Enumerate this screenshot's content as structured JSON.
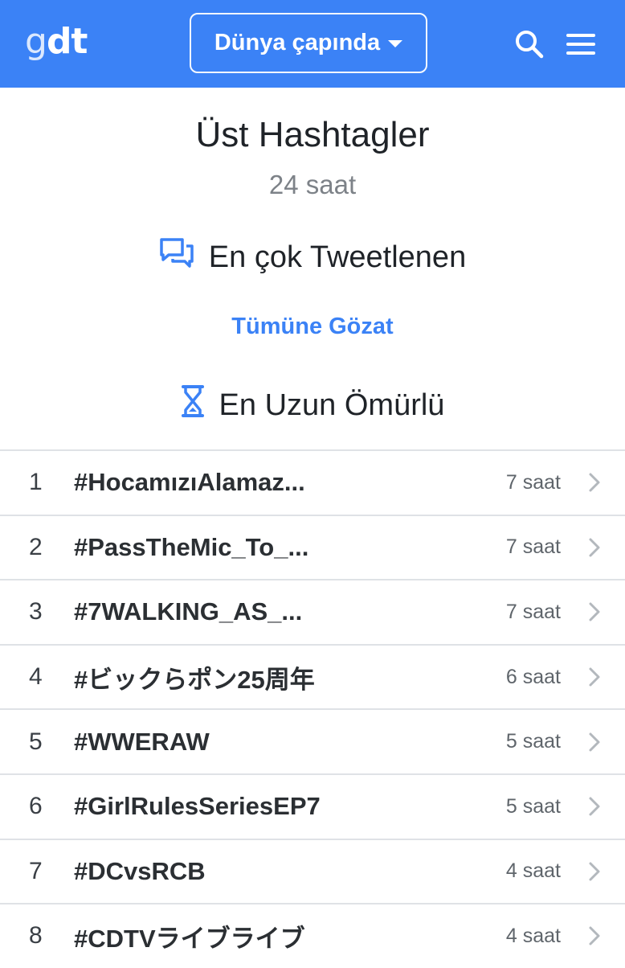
{
  "header": {
    "logo_g": "g",
    "logo_dt": "dt",
    "region_label": "Dünya çapında",
    "search_icon": "search-icon",
    "menu_icon": "menu-icon",
    "color": "#3b82f6"
  },
  "main": {
    "title": "Üst Hashtagler",
    "subtitle": "24 saat",
    "most_tweeted_label": "En çok Tweetlenen",
    "browse_all": "Tümüne Gözat",
    "longest_lived_label": "En Uzun Ömürlü"
  },
  "list": [
    {
      "rank": "1",
      "tag": "#HocamızıAlamaz...",
      "duration": "7 saat"
    },
    {
      "rank": "2",
      "tag": "#PassTheMic_To_...",
      "duration": "7 saat"
    },
    {
      "rank": "3",
      "tag": "#7WALKING_AS_...",
      "duration": "7 saat"
    },
    {
      "rank": "4",
      "tag": "#ビックらポン25周年",
      "duration": "6 saat"
    },
    {
      "rank": "5",
      "tag": "#WWERAW",
      "duration": "5 saat"
    },
    {
      "rank": "6",
      "tag": "#GirlRulesSeriesEP7",
      "duration": "5 saat"
    },
    {
      "rank": "7",
      "tag": "#DCvsRCB",
      "duration": "4 saat"
    },
    {
      "rank": "8",
      "tag": "#CDTVライブライブ",
      "duration": "4 saat"
    }
  ]
}
